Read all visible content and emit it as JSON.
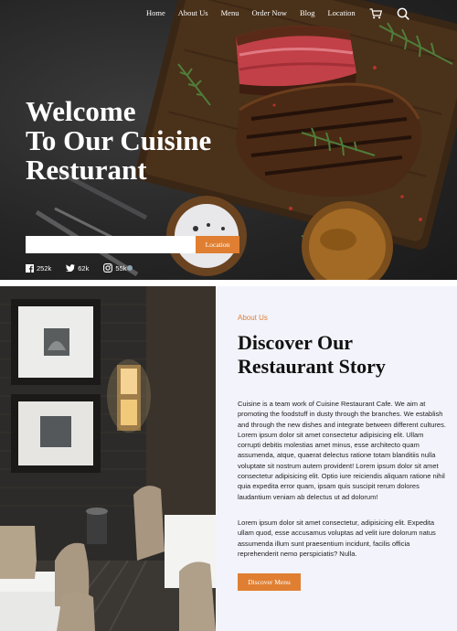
{
  "nav": {
    "links": [
      "Home",
      "About Us",
      "Menu",
      "Order Now",
      "Blog",
      "Location"
    ]
  },
  "hero": {
    "title_lines": [
      "Welcome",
      "To Our Cuisine",
      "Resturant"
    ],
    "location_input_value": "",
    "location_button": "Location",
    "social": [
      {
        "icon": "facebook-icon",
        "count": "252k"
      },
      {
        "icon": "twitter-icon",
        "count": "62k"
      },
      {
        "icon": "instagram-icon",
        "count": "55k"
      }
    ]
  },
  "story": {
    "eyebrow": "About Us",
    "title_lines": [
      "Discover Our",
      "Restaurant Story"
    ],
    "paragraph1": "Cuisine is a team work of Cuisine Restaurant Cafe. We aim at promoting the foodstuff in dusty through the branches. We establish and through the new dishes and integrate between different cultures. Lorem ipsum dolor sit amet consectetur adipisicing elit. Ullam corrupti debitis molestias amet minus, esse architecto quam assumenda, atque, quaerat delectus ratione totam blanditiis nulla voluptate sit nostrum autem provident! Lorem ipsum dolor sit amet consectetur adipisicing elit. Optio iure reiciendis aliquam ratione nihil quia expedita error quam, ipsam quis suscipit rerum dolores laudantium veniam ab delectus ut ad dolorum!",
    "paragraph2": "Lorem ipsum dolor sit amet consectetur, adipisicing elit. Expedita ullam quod, esse accusamus voluptas ad velit iure dolorum natus assumenda illum sunt praesentium incidunt, facilis officia reprehenderit nemo perspiciatis? Nulla.",
    "button": "Discover Menu"
  },
  "colors": {
    "accent": "#e07f32",
    "panel_bg": "#f3f3fb",
    "hero_bg": "#262626"
  }
}
